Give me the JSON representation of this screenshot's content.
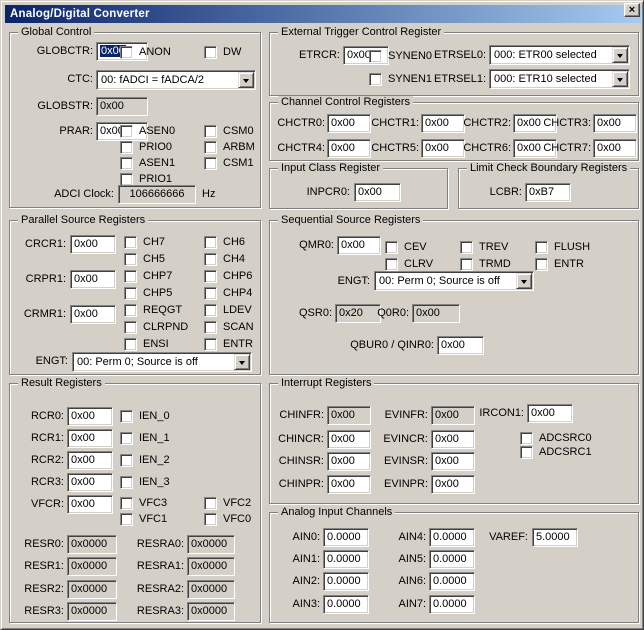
{
  "window": {
    "title": "Analog/Digital Converter"
  },
  "icons": {
    "close": "×"
  },
  "colors": {
    "titlebar_left": "#0a246a",
    "titlebar_right": "#a6caf0",
    "selection": "#0a246a"
  },
  "global_control": {
    "title": "Global Control",
    "globctr_label": "GLOBCTR:",
    "globctr_value": "0x00",
    "anon_label": "ANON",
    "dw_label": "DW",
    "ctc_label": "CTC:",
    "ctc_value": "00: fADCI = fADCA/2",
    "globstr_label": "GLOBSTR:",
    "globstr_value": "0x00",
    "prar_label": "PRAR:",
    "prar_value": "0x00",
    "prar_col1": [
      "ASEN0",
      "PRIO0",
      "ASEN1",
      "PRIO1"
    ],
    "prar_col2": [
      "CSM0",
      "ARBM",
      "CSM1"
    ],
    "adci_label": "ADCI Clock:",
    "adci_value": "106666666",
    "adci_unit": "Hz"
  },
  "external_trigger": {
    "title": "External Trigger Control Register",
    "etrcr_label": "ETRCR:",
    "etrcr_value": "0x00",
    "synen0_label": "SYNEN0",
    "synen1_label": "SYNEN1",
    "etrsel0_label": "ETRSEL0:",
    "etrsel0_value": "000: ETR00 selected",
    "etrsel1_label": "ETRSEL1:",
    "etrsel1_value": "000: ETR10 selected"
  },
  "channel_control": {
    "title": "Channel Control Registers",
    "registers": [
      {
        "label": "CHCTR0:",
        "value": "0x00"
      },
      {
        "label": "CHCTR1:",
        "value": "0x00"
      },
      {
        "label": "CHCTR2:",
        "value": "0x00"
      },
      {
        "label": "CHCTR3:",
        "value": "0x00"
      },
      {
        "label": "CHCTR4:",
        "value": "0x00"
      },
      {
        "label": "CHCTR5:",
        "value": "0x00"
      },
      {
        "label": "CHCTR6:",
        "value": "0x00"
      },
      {
        "label": "CHCTR7:",
        "value": "0x00"
      }
    ]
  },
  "input_class": {
    "title": "Input Class Register",
    "inpcr0_label": "INPCR0:",
    "inpcr0_value": "0x00"
  },
  "limit_check": {
    "title": "Limit Check Boundary Registers",
    "lcbr_label": "LCBR:",
    "lcbr_value": "0xB7"
  },
  "parallel_source": {
    "title": "Parallel Source Registers",
    "crcr1_label": "CRCR1:",
    "crcr1_value": "0x00",
    "crpr1_label": "CRPR1:",
    "crpr1_value": "0x00",
    "crmr1_label": "CRMR1:",
    "crmr1_value": "0x00",
    "col1": [
      "CH7",
      "CH5",
      "CHP7",
      "CHP5",
      "REQGT",
      "CLRPND",
      "ENSI"
    ],
    "col2": [
      "CH6",
      "CH4",
      "CHP6",
      "CHP4",
      "LDEV",
      "SCAN",
      "ENTR"
    ],
    "engt_label": "ENGT:",
    "engt_value": "00: Perm 0; Source is off"
  },
  "sequential_source": {
    "title": "Sequential Source Registers",
    "qmr0_label": "QMR0:",
    "qmr0_value": "0x00",
    "row1": [
      "CEV",
      "TREV",
      "FLUSH"
    ],
    "row2": [
      "CLRV",
      "TRMD",
      "ENTR"
    ],
    "engt_label": "ENGT:",
    "engt_value": "00: Perm 0; Source is off",
    "qsr0_label": "QSR0:",
    "qsr0_value": "0x20",
    "q0r0_label": "Q0R0:",
    "q0r0_value": "0x00",
    "qbur0_label": "QBUR0 / QINR0:",
    "qbur0_value": "0x00"
  },
  "result_registers": {
    "title": "Result Registers",
    "rcr": [
      {
        "label": "RCR0:",
        "value": "0x00",
        "cb": "IEN_0"
      },
      {
        "label": "RCR1:",
        "value": "0x00",
        "cb": "IEN_1"
      },
      {
        "label": "RCR2:",
        "value": "0x00",
        "cb": "IEN_2"
      },
      {
        "label": "RCR3:",
        "value": "0x00",
        "cb": "IEN_3"
      }
    ],
    "vfcr_label": "VFCR:",
    "vfcr_value": "0x00",
    "vfc_labels": [
      "VFC3",
      "VFC2",
      "VFC1",
      "VFC0"
    ],
    "resr": [
      {
        "label": "RESR0:",
        "value": "0x0000"
      },
      {
        "label": "RESR1:",
        "value": "0x0000"
      },
      {
        "label": "RESR2:",
        "value": "0x0000"
      },
      {
        "label": "RESR3:",
        "value": "0x0000"
      }
    ],
    "resra": [
      {
        "label": "RESRA0:",
        "value": "0x0000"
      },
      {
        "label": "RESRA1:",
        "value": "0x0000"
      },
      {
        "label": "RESRA2:",
        "value": "0x0000"
      },
      {
        "label": "RESRA3:",
        "value": "0x0000"
      }
    ]
  },
  "interrupt_registers": {
    "title": "Interrupt Registers",
    "col1": [
      {
        "label": "CHINFR:",
        "value": "0x00",
        "readonly": true
      },
      {
        "label": "CHINCR:",
        "value": "0x00"
      },
      {
        "label": "CHINSR:",
        "value": "0x00"
      },
      {
        "label": "CHINPR:",
        "value": "0x00"
      }
    ],
    "col2": [
      {
        "label": "EVINFR:",
        "value": "0x00",
        "readonly": true
      },
      {
        "label": "EVINCR:",
        "value": "0x00"
      },
      {
        "label": "EVINSR:",
        "value": "0x00"
      },
      {
        "label": "EVINPR:",
        "value": "0x00"
      }
    ],
    "ircon1_label": "IRCON1:",
    "ircon1_value": "0x00",
    "adcsrc0_label": "ADCSRC0",
    "adcsrc1_label": "ADCSRC1"
  },
  "analog_inputs": {
    "title": "Analog Input Channels",
    "col1": [
      {
        "label": "AIN0:",
        "value": "0.0000"
      },
      {
        "label": "AIN1:",
        "value": "0.0000"
      },
      {
        "label": "AIN2:",
        "value": "0.0000"
      },
      {
        "label": "AIN3:",
        "value": "0.0000"
      }
    ],
    "col2": [
      {
        "label": "AIN4:",
        "value": "0.0000"
      },
      {
        "label": "AIN5:",
        "value": "0.0000"
      },
      {
        "label": "AIN6:",
        "value": "0.0000"
      },
      {
        "label": "AIN7:",
        "value": "0.0000"
      }
    ],
    "varef_label": "VAREF:",
    "varef_value": "5.0000"
  }
}
